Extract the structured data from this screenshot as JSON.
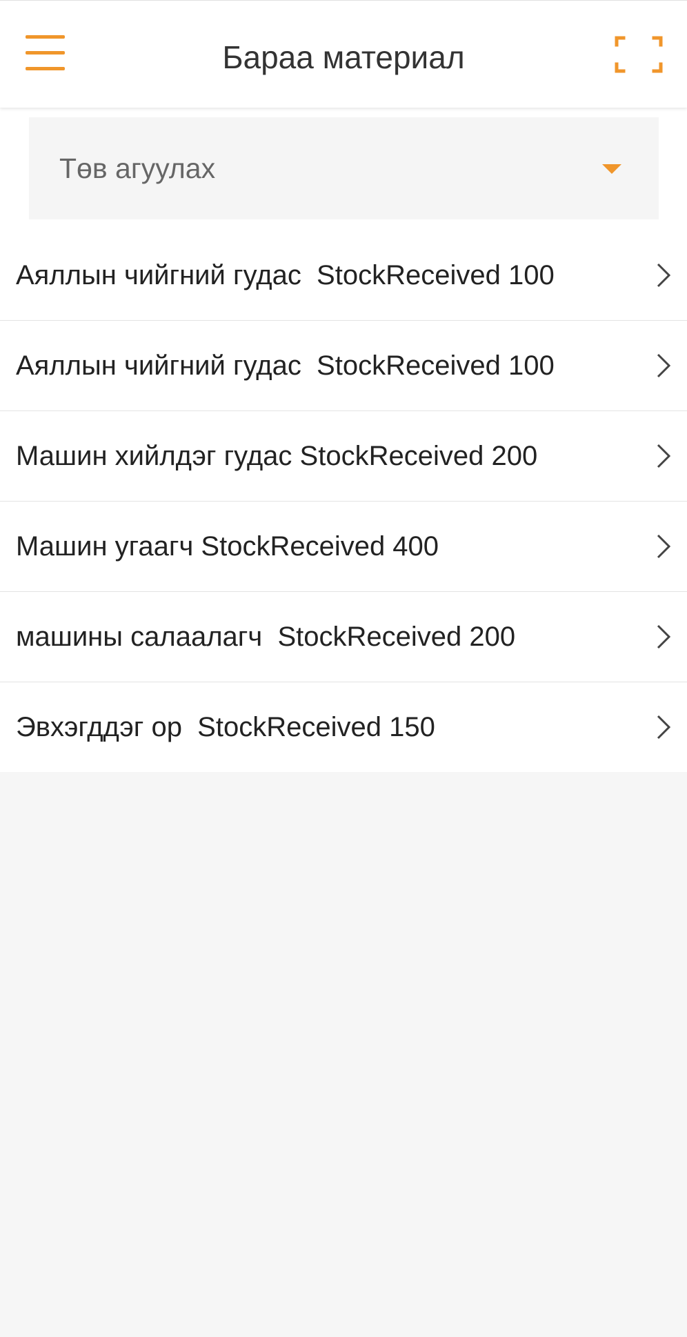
{
  "header": {
    "title": "Бараа материал",
    "menu_icon": "hamburger-menu-icon",
    "scan_icon": "scan-frame-icon",
    "accent_color": "#f0962b"
  },
  "filter": {
    "selected": "Төв агуулах",
    "icon": "dropdown-caret-icon"
  },
  "items": [
    {
      "label": "Аяллын чийгний гудас  StockReceived 100"
    },
    {
      "label": "Аяллын чийгний гудас  StockReceived 100"
    },
    {
      "label": "Машин хийлдэг гудас StockReceived 200"
    },
    {
      "label": "Машин угаагч StockReceived 400"
    },
    {
      "label": "машины салаалагч  StockReceived 200"
    },
    {
      "label": "Эвхэгддэг ор  StockReceived 150"
    }
  ],
  "colors": {
    "background": "#f6f6f6",
    "surface": "#ffffff",
    "select_background": "#f5f5f5",
    "divider": "#e3e3e3"
  }
}
